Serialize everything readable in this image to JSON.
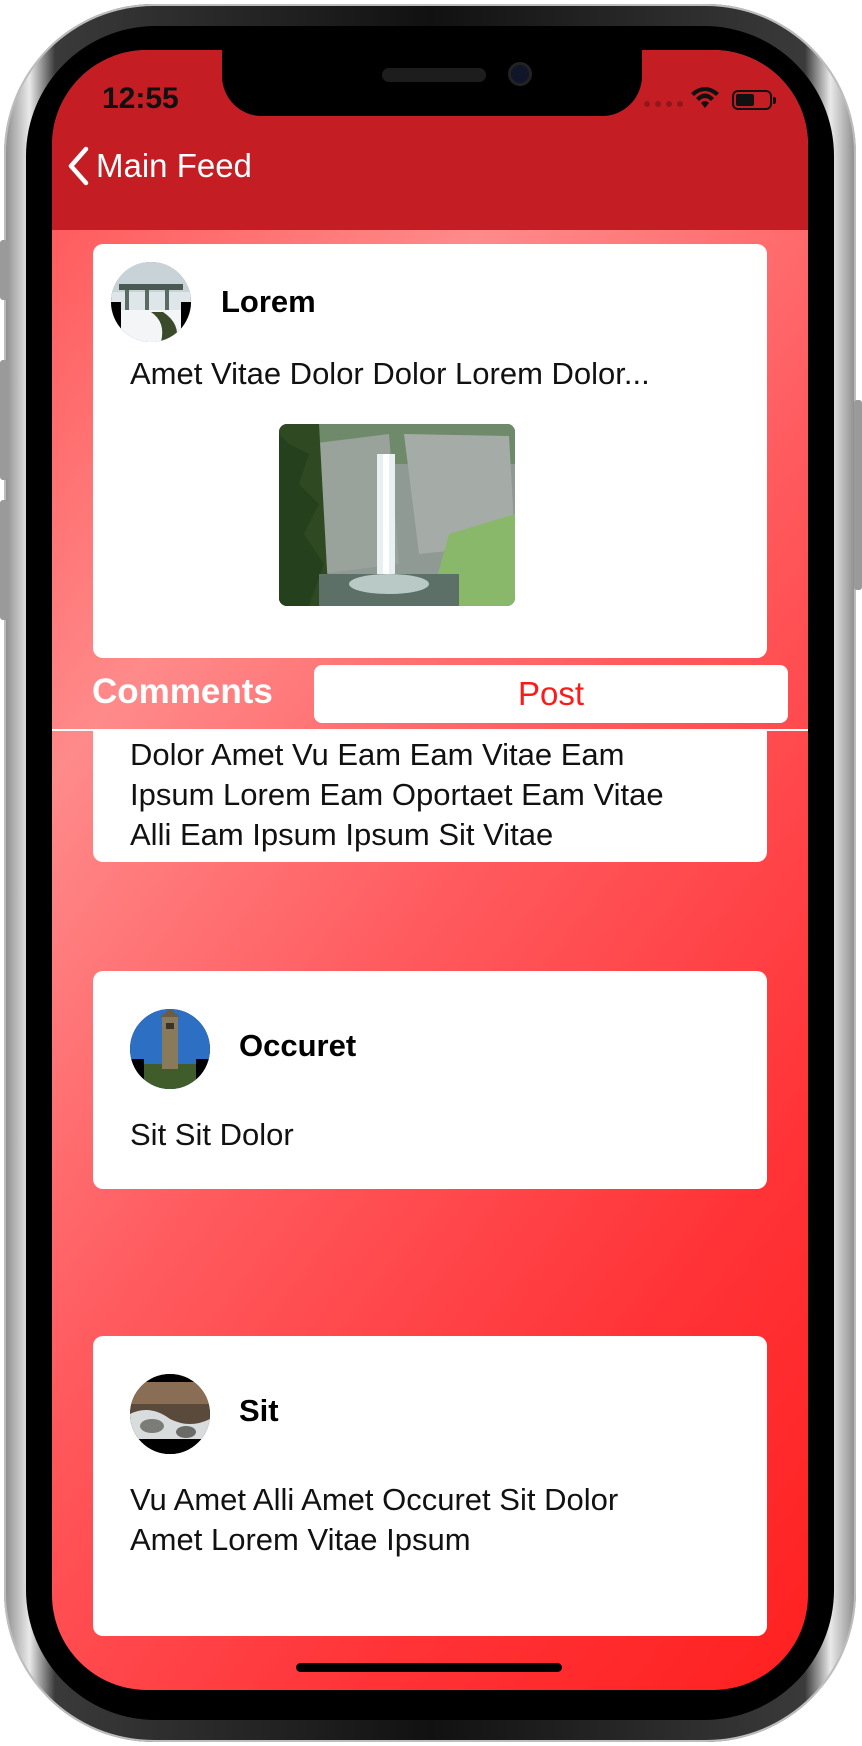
{
  "status_bar": {
    "time": "12:55"
  },
  "nav": {
    "back_label": "Main Feed"
  },
  "post": {
    "author": "Lorem",
    "text": "Amet Vitae Dolor Dolor Lorem Dolor...",
    "avatar_image": "bridge-snow-photo",
    "post_image": "waterfall-photo"
  },
  "comments_section": {
    "title": "Comments",
    "post_button": "Post"
  },
  "comments": [
    {
      "author": "",
      "text_lines": [
        "Dolor Amet Vu Eam Eam Vitae Eam",
        "Ipsum Lorem Eam Oportaet Eam Vitae",
        "Alli Eam Ipsum Ipsum Sit Vitae"
      ]
    },
    {
      "author": "Occuret",
      "text_lines": [
        "Sit Sit Dolor"
      ],
      "avatar_image": "clock-tower-photo"
    },
    {
      "author": "Sit",
      "text_lines": [
        "Vu Amet Alli Amet Occuret Sit Dolor",
        "Amet Lorem Vitae Ipsum"
      ],
      "avatar_image": "stream-rocks-photo"
    }
  ],
  "colors": {
    "nav_red": "#c41e24",
    "accent_red": "#ff1a1a",
    "background_red": "#ff3337"
  }
}
